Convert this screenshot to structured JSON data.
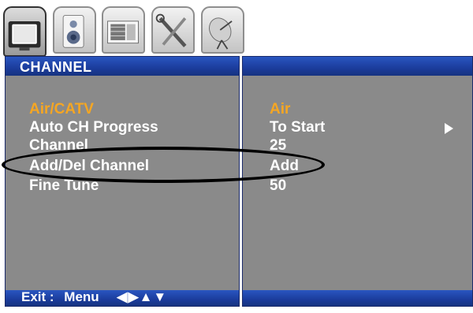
{
  "tabs": [
    {
      "icon": "tv-icon",
      "active": true
    },
    {
      "icon": "speaker-icon",
      "active": false
    },
    {
      "icon": "screen-icon",
      "active": false
    },
    {
      "icon": "tools-icon",
      "active": false
    },
    {
      "icon": "satellite-dish-icon",
      "active": false
    }
  ],
  "menu": {
    "title": "CHANNEL",
    "items": [
      {
        "label": "Air/CATV",
        "value": "Air",
        "selected": true
      },
      {
        "label": "Auto CH Progress",
        "value": "To Start",
        "has_submenu": true
      },
      {
        "label": "Channel",
        "value": "25"
      },
      {
        "label": "Add/Del Channel",
        "value": "Add",
        "highlighted": true
      },
      {
        "label": "Fine Tune",
        "value": "50"
      }
    ]
  },
  "footer": {
    "exit_label": "Exit :",
    "menu_label": "Menu",
    "nav_arrows": "◀▶▲▼"
  },
  "colors": {
    "panel": "#8a8a8a",
    "bar": "#1b3c9c",
    "selected_text": "#f5a623",
    "text": "#ffffff"
  }
}
